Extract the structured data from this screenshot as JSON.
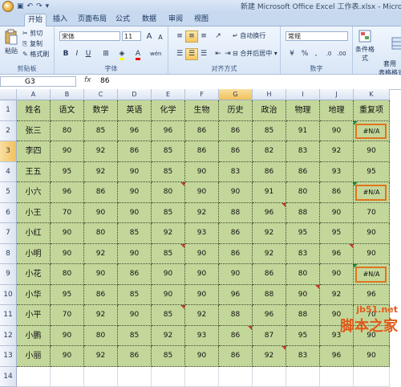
{
  "window": {
    "title": "新建 Microsoft Office Excel 工作表.xlsx - Microsoft"
  },
  "tabs": [
    "开始",
    "插入",
    "页面布局",
    "公式",
    "数据",
    "审阅",
    "视图"
  ],
  "ribbon": {
    "clipboard": {
      "paste": "粘贴",
      "cut": "剪切",
      "copy": "复制",
      "format_painter": "格式刷",
      "label": "剪贴板"
    },
    "font": {
      "name": "宋体",
      "size": "11",
      "bold": "B",
      "italic": "I",
      "underline": "U",
      "grow": "A",
      "shrink": "A",
      "font_color_letter": "A",
      "phonetic": "wén",
      "label": "字体"
    },
    "alignment": {
      "wrap": "自动换行",
      "merge": "合并后居中",
      "label": "对齐方式"
    },
    "number": {
      "format": "常规",
      "percent": "%",
      "comma": ",",
      "label": "数字"
    },
    "styles": {
      "conditional": "条件格式",
      "table": "套用\n表格格式"
    }
  },
  "formula_bar": {
    "name_box": "G3",
    "fx": "fx",
    "value": "86"
  },
  "columns": [
    "A",
    "B",
    "C",
    "D",
    "E",
    "F",
    "G",
    "H",
    "I",
    "J",
    "K"
  ],
  "rows": [
    [
      "姓名",
      "语文",
      "数学",
      "英语",
      "化学",
      "生物",
      "历史",
      "政治",
      "物理",
      "地理",
      "重复项"
    ],
    [
      "张三",
      "80",
      "85",
      "96",
      "96",
      "86",
      "86",
      "85",
      "91",
      "90",
      "#N/A"
    ],
    [
      "李四",
      "90",
      "92",
      "86",
      "85",
      "86",
      "86",
      "82",
      "83",
      "92",
      "90"
    ],
    [
      "王五",
      "95",
      "92",
      "90",
      "85",
      "90",
      "83",
      "86",
      "86",
      "93",
      "95"
    ],
    [
      "小六",
      "96",
      "86",
      "90",
      "80",
      "90",
      "90",
      "91",
      "80",
      "86",
      "#N/A"
    ],
    [
      "小王",
      "70",
      "90",
      "90",
      "85",
      "92",
      "88",
      "96",
      "88",
      "90",
      "70"
    ],
    [
      "小红",
      "90",
      "80",
      "85",
      "92",
      "93",
      "86",
      "92",
      "95",
      "95",
      "90"
    ],
    [
      "小明",
      "90",
      "92",
      "90",
      "85",
      "90",
      "86",
      "92",
      "83",
      "96",
      "90"
    ],
    [
      "小花",
      "80",
      "90",
      "86",
      "90",
      "90",
      "90",
      "86",
      "80",
      "90",
      "#N/A"
    ],
    [
      "小华",
      "95",
      "86",
      "85",
      "90",
      "90",
      "96",
      "88",
      "90",
      "92",
      "96"
    ],
    [
      "小平",
      "70",
      "92",
      "90",
      "85",
      "92",
      "88",
      "96",
      "88",
      "90",
      "70"
    ],
    [
      "小鹏",
      "90",
      "80",
      "85",
      "92",
      "93",
      "86",
      "87",
      "95",
      "93",
      "90"
    ],
    [
      "小丽",
      "90",
      "92",
      "86",
      "85",
      "90",
      "86",
      "92",
      "83",
      "96",
      "90"
    ]
  ],
  "row_numbers": [
    "1",
    "2",
    "3",
    "4",
    "5",
    "6",
    "7",
    "8",
    "9",
    "10",
    "11",
    "12",
    "13",
    "14"
  ],
  "colors": {
    "cell_fill": "#c4d79b",
    "error_border": "#e0741e",
    "watermark": "#e05a1a"
  },
  "watermark": {
    "line1": "jb51.net",
    "line2": "脚本之家"
  }
}
